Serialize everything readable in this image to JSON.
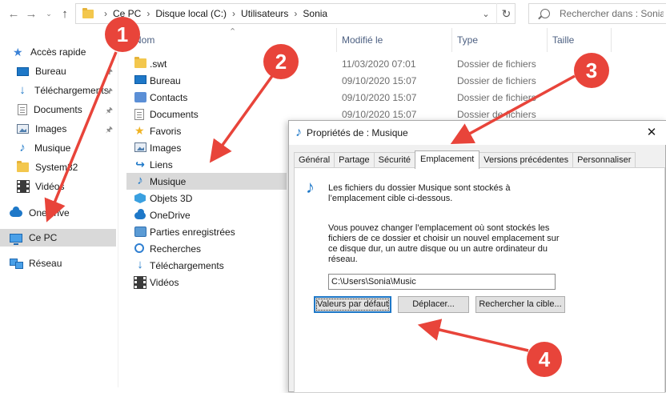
{
  "addressbar": {
    "crumbs": [
      "Ce PC",
      "Disque local (C:)",
      "Utilisateurs",
      "Sonia"
    ],
    "search_placeholder": "Rechercher dans : Sonia"
  },
  "nav": {
    "quick_access": "Accès rapide",
    "items": [
      {
        "label": "Bureau",
        "icon": "desktop-icon",
        "pinned": true
      },
      {
        "label": "Téléchargements",
        "icon": "downloads-icon",
        "pinned": true
      },
      {
        "label": "Documents",
        "icon": "documents-icon",
        "pinned": true
      },
      {
        "label": "Images",
        "icon": "pictures-icon",
        "pinned": true
      },
      {
        "label": "Musique",
        "icon": "music-icon",
        "pinned": false
      },
      {
        "label": "System32",
        "icon": "folder-icon",
        "pinned": false
      },
      {
        "label": "Vidéos",
        "icon": "videos-icon",
        "pinned": false
      }
    ],
    "onedrive": "OneDrive",
    "this_pc": "Ce PC",
    "network": "Réseau"
  },
  "filelist": {
    "columns": {
      "name": "Nom",
      "modified": "Modifié le",
      "type": "Type",
      "size": "Taille"
    },
    "rows": [
      {
        "name": ".swt",
        "modified": "11/03/2020 07:01",
        "type": "Dossier de fichiers",
        "icon": "folder-icon"
      },
      {
        "name": "Bureau",
        "modified": "09/10/2020 15:07",
        "type": "Dossier de fichiers",
        "icon": "desktop-icon"
      },
      {
        "name": "Contacts",
        "modified": "09/10/2020 15:07",
        "type": "Dossier de fichiers",
        "icon": "contacts-icon"
      },
      {
        "name": "Documents",
        "modified": "09/10/2020 15:07",
        "type": "Dossier de fichiers",
        "icon": "documents-icon"
      },
      {
        "name": "Favoris",
        "modified": "",
        "type": "",
        "icon": "favorites-icon"
      },
      {
        "name": "Images",
        "modified": "",
        "type": "",
        "icon": "pictures-icon"
      },
      {
        "name": "Liens",
        "modified": "",
        "type": "",
        "icon": "links-icon"
      },
      {
        "name": "Musique",
        "modified": "",
        "type": "",
        "icon": "music-icon"
      },
      {
        "name": "Objets 3D",
        "modified": "",
        "type": "",
        "icon": "3d-objects-icon"
      },
      {
        "name": "OneDrive",
        "modified": "",
        "type": "",
        "icon": "onedrive-icon"
      },
      {
        "name": "Parties enregistrées",
        "modified": "",
        "type": "",
        "icon": "saved-games-icon"
      },
      {
        "name": "Recherches",
        "modified": "",
        "type": "",
        "icon": "searches-icon"
      },
      {
        "name": "Téléchargements",
        "modified": "",
        "type": "",
        "icon": "downloads-icon"
      },
      {
        "name": "Vidéos",
        "modified": "",
        "type": "",
        "icon": "videos-icon"
      }
    ]
  },
  "dialog": {
    "title": "Propriétés de : Musique",
    "tabs": [
      "Général",
      "Partage",
      "Sécurité",
      "Emplacement",
      "Versions précédentes",
      "Personnaliser"
    ],
    "active_tab": "Emplacement",
    "description": "Les fichiers du dossier Musique sont stockés à l’emplacement cible ci-dessous.",
    "explanation": "Vous pouvez changer l’emplacement où sont stockés les fichiers de ce dossier et choisir un nouvel emplacement sur ce disque dur, un autre disque ou un autre ordinateur du réseau.",
    "path": "C:\\Users\\Sonia\\Music",
    "buttons": {
      "default": "Valeurs par défaut",
      "move": "Déplacer...",
      "find_target": "Rechercher la cible..."
    }
  },
  "annotations": {
    "badges": [
      "1",
      "2",
      "3",
      "4"
    ],
    "color": "#e8443a"
  }
}
